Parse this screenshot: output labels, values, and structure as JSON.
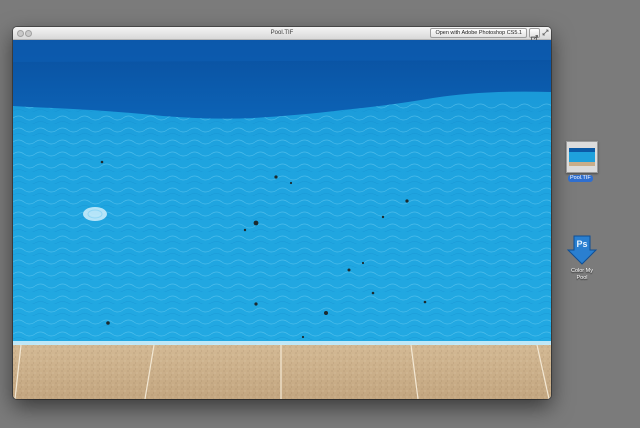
{
  "window": {
    "title": "Pool.TIF",
    "open_with_label": "Open with Adobe Photoshop CS5.1",
    "share_icon": "share-icon",
    "fullscreen_icon": "fullscreen-icon"
  },
  "preview": {
    "description_colors": {
      "water": "#1ea1dc",
      "shadow": "#0b5aa6",
      "coping": "#c8ad89"
    }
  },
  "desktop": {
    "background": "#7b7b7b",
    "file_icon": {
      "label": "Pool.TIF",
      "selected_color": "#2f6fcf"
    },
    "droplet": {
      "badge": "Ps",
      "label_line1": "Color My",
      "label_line2": "Pool",
      "color": "#2a7fd0"
    }
  }
}
